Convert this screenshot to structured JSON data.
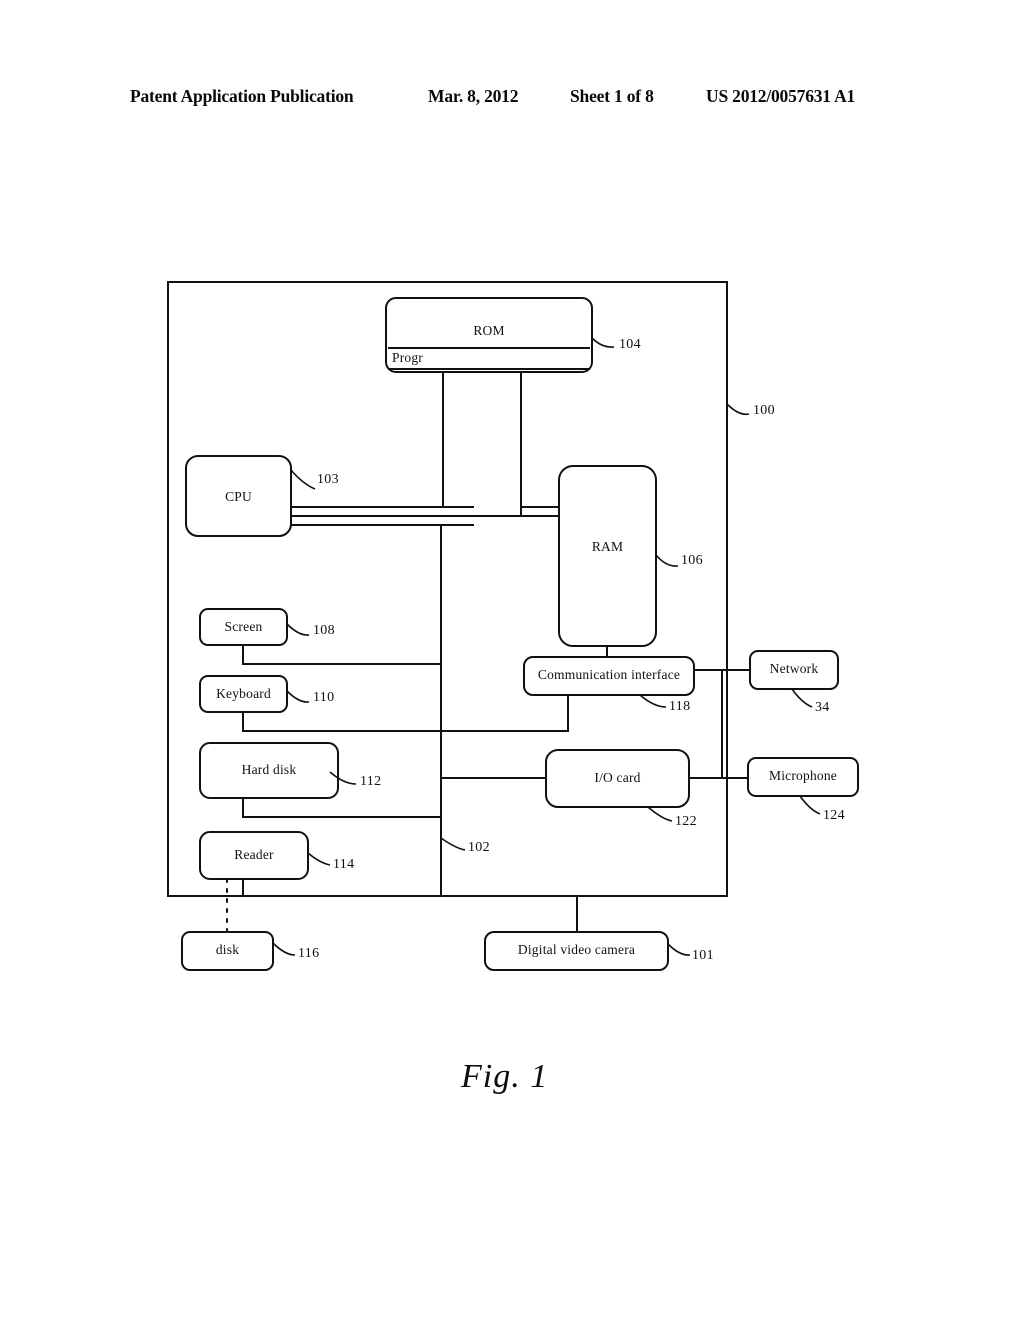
{
  "header": {
    "publication": "Patent Application Publication",
    "date": "Mar. 8, 2012",
    "sheet": "Sheet 1 of 8",
    "patent_number": "US 2012/0057631 A1"
  },
  "figure": {
    "caption": "Fig. 1",
    "system_ref": "100",
    "bus_ref": "102",
    "blocks": [
      {
        "id": "rom",
        "label": "ROM",
        "ref": "104"
      },
      {
        "id": "rom_progr",
        "label": "Progr",
        "ref": ""
      },
      {
        "id": "cpu",
        "label": "CPU",
        "ref": "103"
      },
      {
        "id": "ram",
        "label": "RAM",
        "ref": "106"
      },
      {
        "id": "screen",
        "label": "Screen",
        "ref": "108"
      },
      {
        "id": "keyboard",
        "label": "Keyboard",
        "ref": "110"
      },
      {
        "id": "hard_disk",
        "label": "Hard disk",
        "ref": "112"
      },
      {
        "id": "reader",
        "label": "Reader",
        "ref": "114"
      },
      {
        "id": "disk",
        "label": "disk",
        "ref": "116"
      },
      {
        "id": "comm_if",
        "label": "Communication interface",
        "ref": "118"
      },
      {
        "id": "network",
        "label": "Network",
        "ref": "34"
      },
      {
        "id": "io_card",
        "label": "I/O card",
        "ref": "122"
      },
      {
        "id": "microphone",
        "label": "Microphone",
        "ref": "124"
      },
      {
        "id": "camera",
        "label": "Digital video camera",
        "ref": "101"
      }
    ]
  },
  "colors": {
    "ink": "#111111",
    "paper": "#ffffff"
  }
}
